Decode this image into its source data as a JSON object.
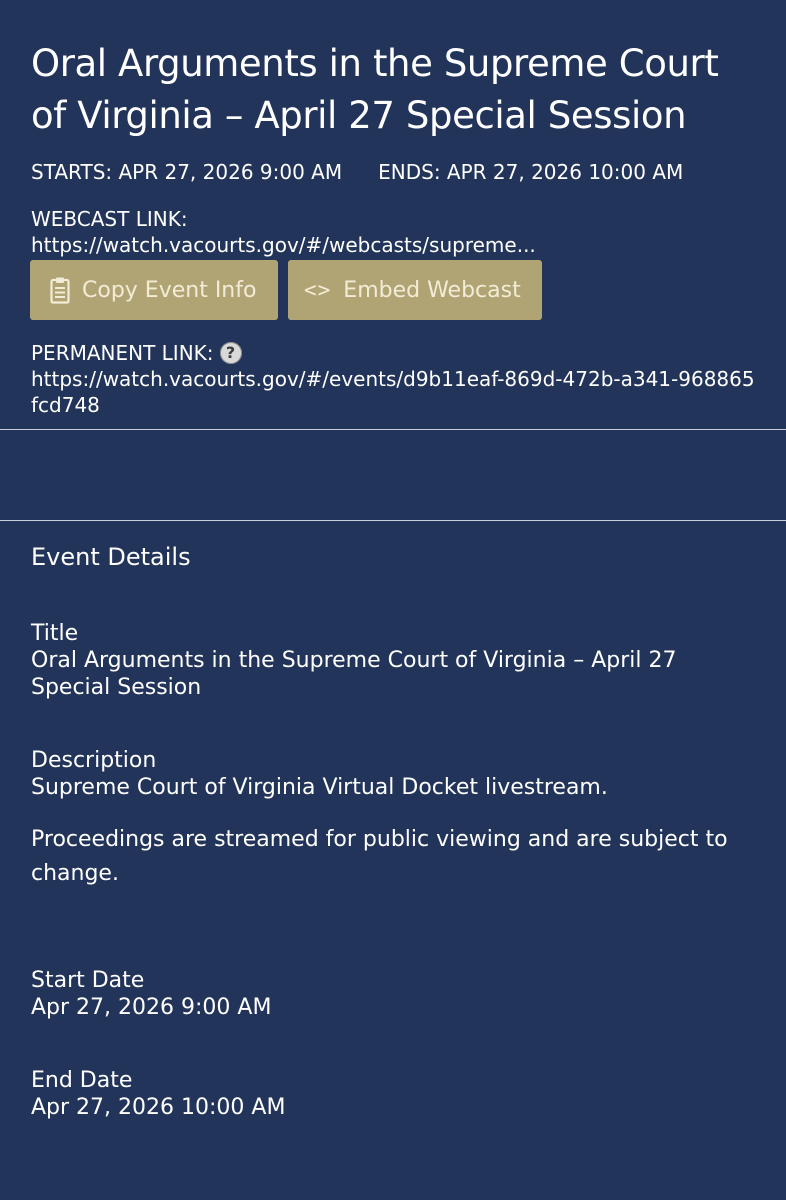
{
  "event": {
    "title": "Oral Arguments in the Supreme Court of Virginia – April 27 Special Session",
    "starts": "STARTS: APR 27, 2026 9:00 AM",
    "ends": "ENDS: APR 27, 2026 10:00 AM",
    "webcast_label": "WEBCAST LINK:",
    "webcast_url": "https://watch.vacourts.gov/#/webcasts/supreme...",
    "permanent_label": "PERMANENT LINK:",
    "permanent_url": "https://watch.vacourts.gov/#/events/d9b11eaf-869d-472b-a341-968865fcd748"
  },
  "buttons": {
    "copy_label": "Copy Event Info",
    "copy_icon": "clipboard-icon",
    "embed_label": "Embed Webcast",
    "embed_glyph": "<>",
    "embed_icon": "code-icon"
  },
  "help_icon": {
    "glyph": "?",
    "name": "help-icon"
  },
  "details": {
    "heading": "Event Details",
    "title_label": "Title",
    "title_value": "Oral Arguments in the Supreme Court of Virginia – April 27 Special Session",
    "description_label": "Description",
    "description_para1": "Supreme Court of Virginia Virtual Docket livestream.",
    "description_para2": "Proceedings are streamed for public viewing and are subject to change.",
    "start_label": "Start Date",
    "start_value": "Apr 27, 2026 9:00 AM",
    "end_label": "End Date",
    "end_value": "Apr 27, 2026 10:00 AM"
  },
  "colors": {
    "background": "#22345a",
    "button_background": "#b1a474",
    "button_text": "#f2ecd6",
    "text": "#ffffff",
    "divider": "#c9ceda"
  }
}
